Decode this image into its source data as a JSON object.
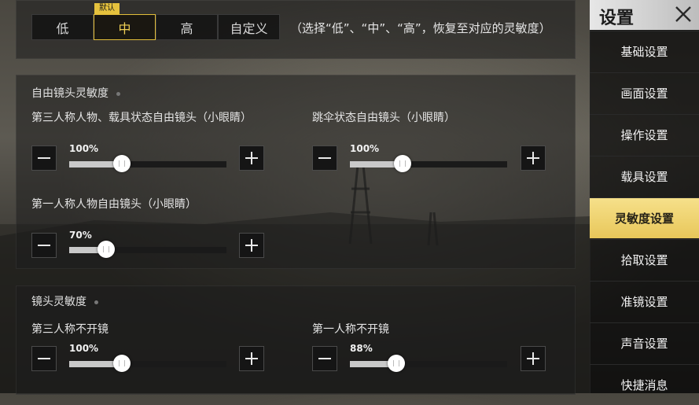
{
  "colors": {
    "accent": "#e6c23d",
    "active_item_bg": "#ecd06a"
  },
  "preset": {
    "badge": "默认",
    "options": [
      "低",
      "中",
      "高",
      "自定义"
    ],
    "selected": "中",
    "note": "（选择“低”、“中”、“高”，恢复至对应的灵敏度）"
  },
  "free_camera": {
    "title": "自由镜头灵敏度",
    "settings": [
      {
        "label": "第三人称人物、载具状态自由镜头（小眼睛）",
        "value": 100,
        "display": "100%"
      },
      {
        "label": "跳伞状态自由镜头（小眼睛）",
        "value": 100,
        "display": "100%"
      },
      {
        "label": "第一人称人物自由镜头（小眼睛）",
        "value": 70,
        "display": "70%"
      }
    ]
  },
  "camera": {
    "title": "镜头灵敏度",
    "settings": [
      {
        "label": "第三人称不开镜",
        "value": 100,
        "display": "100%"
      },
      {
        "label": "第一人称不开镜",
        "value": 88,
        "display": "88%"
      }
    ]
  },
  "slider_max": 300,
  "sidebar": {
    "title": "设置",
    "close_icon": "close-icon",
    "items": [
      {
        "label": "基础设置",
        "active": false
      },
      {
        "label": "画面设置",
        "active": false
      },
      {
        "label": "操作设置",
        "active": false
      },
      {
        "label": "载具设置",
        "active": false
      },
      {
        "label": "灵敏度设置",
        "active": true
      },
      {
        "label": "拾取设置",
        "active": false
      },
      {
        "label": "准镜设置",
        "active": false
      },
      {
        "label": "声音设置",
        "active": false
      },
      {
        "label": "快捷消息",
        "active": false
      }
    ]
  }
}
